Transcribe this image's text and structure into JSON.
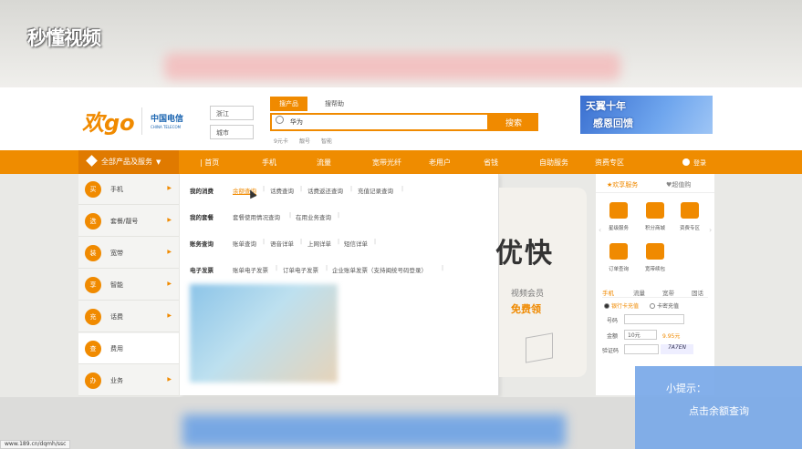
{
  "watermark": "秒懂视频",
  "header": {
    "logo_text": "欢go",
    "partner_logo": "中国电信",
    "partner_sub": "CHINA TELECOM",
    "province": "浙江",
    "city": "城市",
    "search": {
      "tabs": [
        "搜产品",
        "搜帮助"
      ],
      "value": "华为",
      "button": "搜索",
      "hot": [
        "9元卡",
        "靓号",
        "智能"
      ]
    },
    "banner": [
      "天翼十年",
      "感恩回馈"
    ]
  },
  "nav": {
    "all_label": "全部产品及服务",
    "items": [
      "首页",
      "手机",
      "流量",
      "宽带光纤",
      "老用户",
      "省钱",
      "自助服务",
      "资费专区"
    ],
    "login": "登录"
  },
  "categories": [
    {
      "icon": "买",
      "label": "手机",
      "arrow": true
    },
    {
      "icon": "选",
      "label": "套餐/靓号",
      "arrow": true
    },
    {
      "icon": "装",
      "label": "宽带",
      "arrow": true
    },
    {
      "icon": "享",
      "label": "智能",
      "arrow": true
    },
    {
      "icon": "充",
      "label": "话费",
      "arrow": true
    },
    {
      "icon": "查",
      "label": "费用",
      "arrow": false
    },
    {
      "icon": "办",
      "label": "业务",
      "arrow": true
    }
  ],
  "dropdown": {
    "rows": [
      {
        "title": "我的消费",
        "links": [
          "余额查询",
          "话费查询",
          "话费返还查询",
          "充值记录查询"
        ]
      },
      {
        "title": "我的套餐",
        "links": [
          "套餐使用情况查询",
          "在用业务查询"
        ]
      },
      {
        "title": "账务查询",
        "links": [
          "账单查询",
          "语音详单",
          "上网详单",
          "短信详单"
        ]
      },
      {
        "title": "电子发票",
        "links": [
          "账单电子发票",
          "订单电子发票",
          "企业账单发票（支持闽统号码登录）"
        ]
      }
    ]
  },
  "promo": {
    "big": "优快",
    "line1": "视频会员",
    "line2": "免费领"
  },
  "right_panel": {
    "tabs": [
      "欢享服务",
      "超值购"
    ],
    "services": [
      "星级服务",
      "积分商城",
      "资费专区",
      "订单查询",
      "宽带续包"
    ],
    "subtabs": [
      "手机",
      "流量",
      "宽带",
      "固话"
    ],
    "radios": [
      "银行卡充值",
      "卡密充值"
    ],
    "number_label": "号码",
    "amount_label": "金额",
    "amount_value": "10元",
    "discount": "9.95元",
    "captcha_label": "验证码",
    "captcha_img": "7A7EN"
  },
  "status_url": "www.189.cn/dqmh/ssc",
  "tip": {
    "title": "小提示：",
    "text": "点击余额查询"
  }
}
